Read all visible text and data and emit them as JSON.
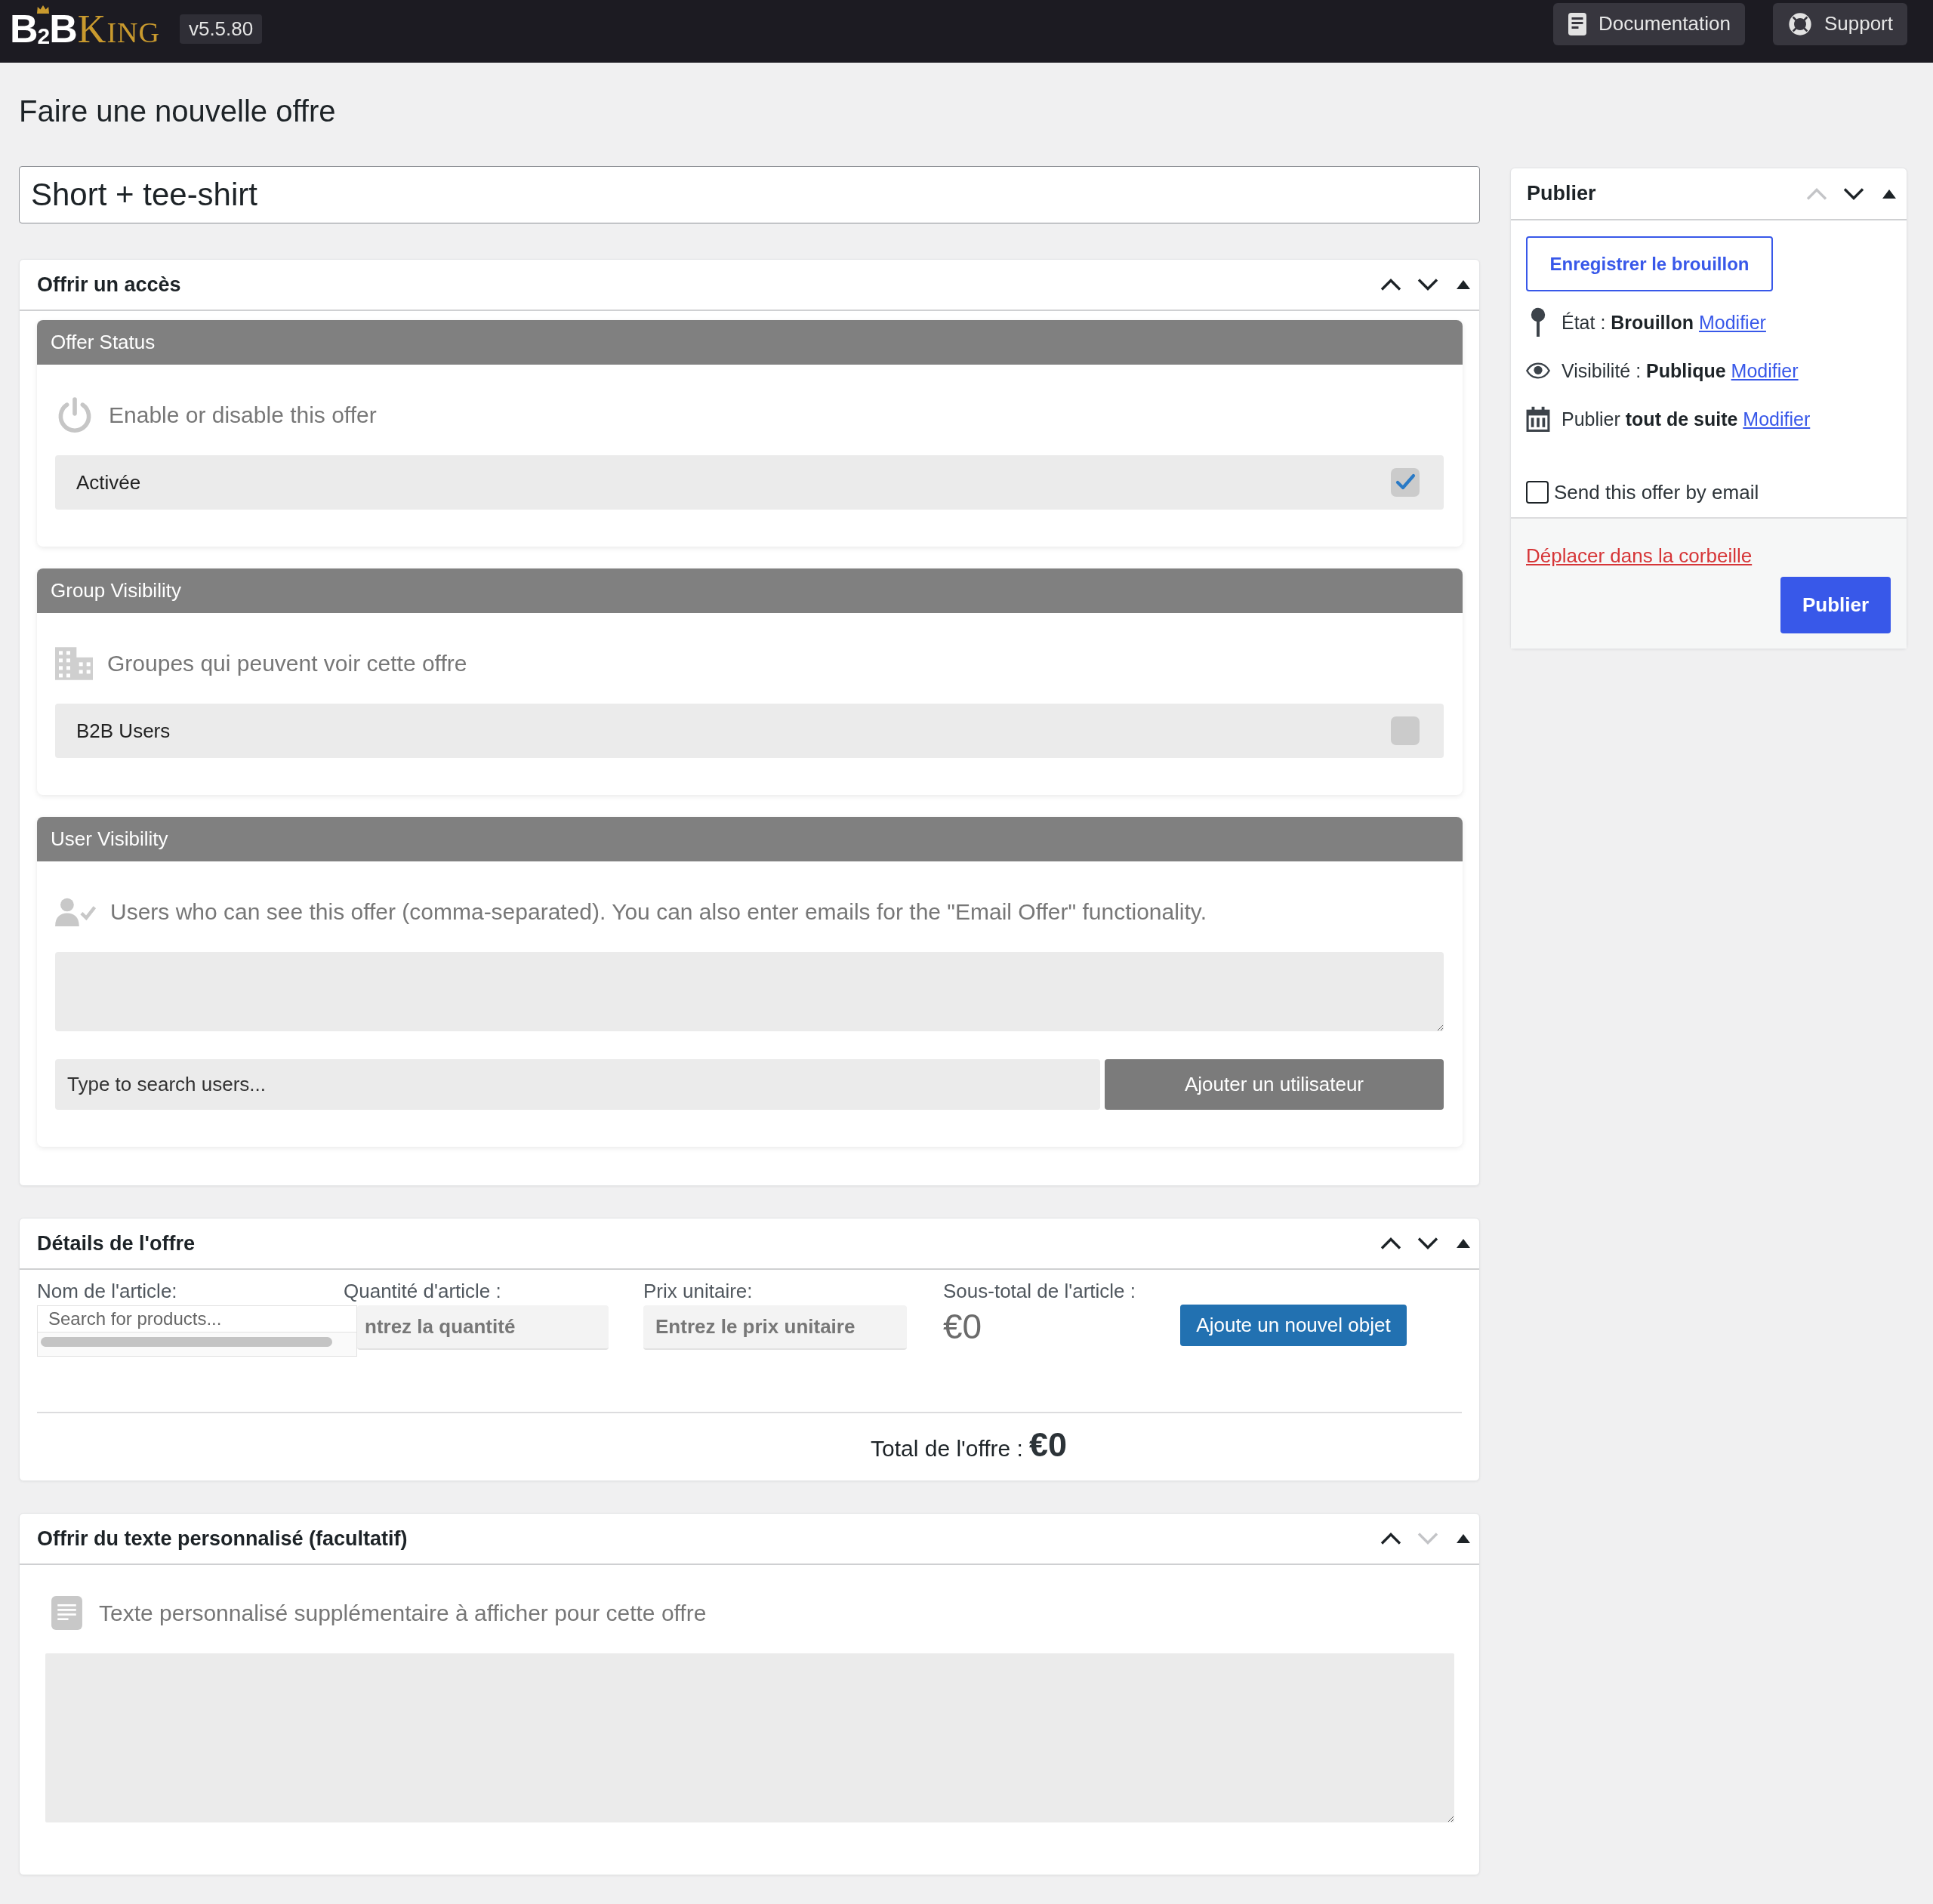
{
  "top_bar": {
    "logo": {
      "mark": "B$_{2}$B",
      "wordmark": "KING"
    },
    "version": "v5.5.80",
    "links": [
      {
        "kind": "documentation",
        "label": "Documentation"
      },
      {
        "kind": "support",
        "label": "Support"
      }
    ]
  },
  "page_title": "Faire une nouvelle offre",
  "title_field": {
    "value": "Short + tee-shirt"
  },
  "postboxes": [
    {
      "kind": "access",
      "title": "Offrir un accès",
      "move_buttons": [
        {
          "kind": "up",
          "disabled": false
        },
        {
          "kind": "down",
          "disabled": false
        },
        {
          "kind": "toggle",
          "disabled": false
        }
      ],
      "panels": [
        {
          "kind": "status",
          "header": "Offer Status",
          "description": "Enable or disable this offer",
          "options": [
            {
              "label": "Activée",
              "checked": true
            }
          ]
        },
        {
          "kind": "groups",
          "header": "Group Visibility",
          "description": "Groupes qui peuvent voir cette offre",
          "options": [
            {
              "label": "B2B Users",
              "checked": false
            }
          ]
        },
        {
          "kind": "users",
          "header": "User Visibility",
          "description": "Users who can see this offer (comma-separated). You can also enter emails for the \"Email Offer\" functionality.",
          "search": {
            "placeholder": "Type to search users..."
          },
          "button": "Ajouter un utilisateur"
        }
      ]
    },
    {
      "kind": "details",
      "title": "Détails de l'offre",
      "move_buttons": [
        {
          "kind": "up",
          "disabled": false
        },
        {
          "kind": "down",
          "disabled": false
        },
        {
          "kind": "toggle",
          "disabled": false
        }
      ],
      "item": {
        "product": {
          "label": "Nom de l'article:",
          "placeholder": "Search for products..."
        },
        "quantity": {
          "label": "Quantité d'article :",
          "placeholder": "ntrez la quantité"
        },
        "unit_price": {
          "label": "Prix unitaire:",
          "placeholder": "Entrez le prix unitaire"
        },
        "subtotal": {
          "label": "Sous-total de l'article :",
          "value": "€0"
        },
        "add_button": "Ajoute un nouvel objet"
      },
      "total": {
        "label": "Total de l'offre :",
        "value": "€0"
      }
    },
    {
      "kind": "custom_text",
      "title": "Offrir du texte personnalisé (facultatif)",
      "move_buttons": [
        {
          "kind": "up",
          "disabled": false
        },
        {
          "kind": "down",
          "disabled": true
        },
        {
          "kind": "toggle",
          "disabled": false
        }
      ],
      "description": "Texte personnalisé supplémentaire à afficher pour cette offre"
    }
  ],
  "publish_box": {
    "title": "Publier",
    "move_buttons": [
      {
        "kind": "up",
        "disabled": true
      },
      {
        "kind": "down",
        "disabled": false
      },
      {
        "kind": "toggle",
        "disabled": false
      }
    ],
    "save_draft": "Enregistrer le brouillon",
    "meta": [
      {
        "kind": "status",
        "text": "État : **Brouillon**",
        "link": "Modifier"
      },
      {
        "kind": "visibility",
        "text": "Visibilité : **Publique**",
        "link": "Modifier"
      },
      {
        "kind": "schedule",
        "text": "Publier **tout de suite**",
        "link": "Modifier"
      }
    ],
    "email": {
      "label": "Send this offer by email",
      "checked": false
    },
    "trash": "Déplacer dans la corbeille",
    "publish": "Publier"
  }
}
